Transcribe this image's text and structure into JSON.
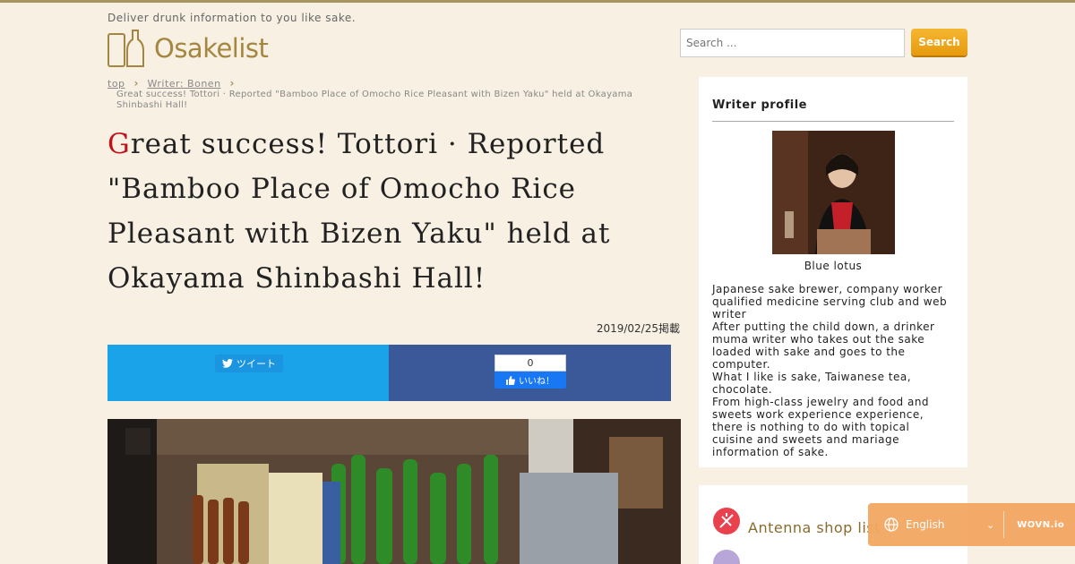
{
  "header": {
    "tagline": "Deliver drunk information to you like sake.",
    "logo_text": "Osakelist",
    "search_placeholder": "Search ...",
    "search_button": "Search"
  },
  "breadcrumb": {
    "items": [
      "top",
      "Writer: Bonen"
    ],
    "current": "Great success! Tottori · Reported \"Bamboo Place of Omocho Rice Pleasant with Bizen Yaku\" held at Okayama Shinbashi Hall!"
  },
  "article": {
    "title_first_letter": "G",
    "title_rest": "reat success! Tottori · Reported \"Bamboo Place of Omocho Rice Pleasant with Bizen Yaku\" held at Okayama Shinbashi Hall!",
    "date": "2019/02/25掲載"
  },
  "share": {
    "tweet_label": "ツイート",
    "like_count": "0",
    "like_label": "いいね！"
  },
  "sidebar": {
    "profile_heading": "Writer profile",
    "writer_name": "Blue lotus",
    "bio": "Japanese sake brewer, company worker qualified medicine serving club and web writer\nAfter putting the child down, a drinker muma writer who takes out the sake loaded with sake and goes to the computer.\nWhat I like is sake, Taiwanese tea, chocolate.\nFrom high-class jewelry and food and sweets work experience experience, there is nothing to do with topical cuisine and sweets and mariage information of sake.",
    "link_antenna": "Antenna shop list"
  },
  "wovn": {
    "language": "English",
    "logo": "WOVN.io"
  },
  "colors": {
    "accent_gold": "#a48640",
    "search_orange": "#f0a820",
    "title_red": "#c0121a",
    "twitter_blue": "#1aa3e8",
    "facebook_blue": "#3b5998"
  }
}
